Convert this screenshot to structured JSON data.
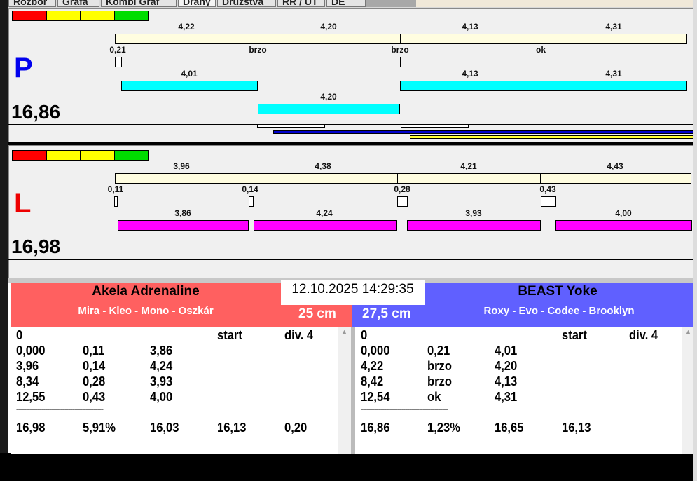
{
  "tabs": [
    "Rozbor",
    "Grafa",
    "Kombi Graf",
    "Dráhy",
    "Družstva",
    "RR / UT",
    "DE"
  ],
  "colors": {
    "red": "#ff0000",
    "yellow": "#ffff00",
    "green": "#00cc00",
    "cream": "#fffde0",
    "cyan": "#00ffff",
    "magenta": "#ff00ff",
    "left_team": "#ff6060",
    "right_team": "#6060ff",
    "blue_line": "#0000cc",
    "yellow_line": "#ffff33"
  },
  "lane_p": {
    "letter": "P",
    "total": "16,86",
    "splits": [
      "4,22",
      "4,20",
      "4,13",
      "4,31"
    ],
    "reactions": [
      "0,21",
      "brzo",
      "brzo",
      "ok"
    ],
    "row1": [
      "4,01",
      "4,13",
      "4,31"
    ],
    "row2": [
      "4,20"
    ]
  },
  "lane_l": {
    "letter": "L",
    "total": "16,98",
    "splits": [
      "3,96",
      "4,38",
      "4,21",
      "4,43"
    ],
    "reactions": [
      "0,11",
      "0,14",
      "0,28",
      "0,43"
    ],
    "row1": [
      "3,86",
      "4,24",
      "3,93",
      "4,00"
    ]
  },
  "timestamp": "12.10.2025 14:29:35",
  "left_team": {
    "name": "Akela Adrenaline",
    "members": "Mira - Kleo - Mono - Oszkár",
    "height": "25 cm",
    "header": [
      "0",
      "start",
      "div. 4"
    ],
    "rows": [
      [
        "0,000",
        "0,11",
        "3,86"
      ],
      [
        "3,96",
        "0,14",
        "4,24"
      ],
      [
        "8,34",
        "0,28",
        "3,93"
      ],
      [
        "12,55",
        "0,43",
        "4,00"
      ]
    ],
    "separator": "---------------------------------------------",
    "totals": [
      "16,98",
      "5,91%",
      "16,03",
      "16,13",
      "0,20"
    ]
  },
  "right_team": {
    "name": "BEAST Yoke",
    "members": "Roxy - Evo - Codee - Brooklyn",
    "height": "27,5 cm",
    "header": [
      "0",
      "start",
      "div. 4"
    ],
    "rows": [
      [
        "0,000",
        "0,21",
        "4,01"
      ],
      [
        "4,22",
        "brzo",
        "4,20"
      ],
      [
        "8,42",
        "brzo",
        "4,13"
      ],
      [
        "12,54",
        "ok",
        "4,31"
      ]
    ],
    "separator": "---------------------------------------------",
    "totals": [
      "16,86",
      "1,23%",
      "16,65",
      "16,13"
    ]
  }
}
